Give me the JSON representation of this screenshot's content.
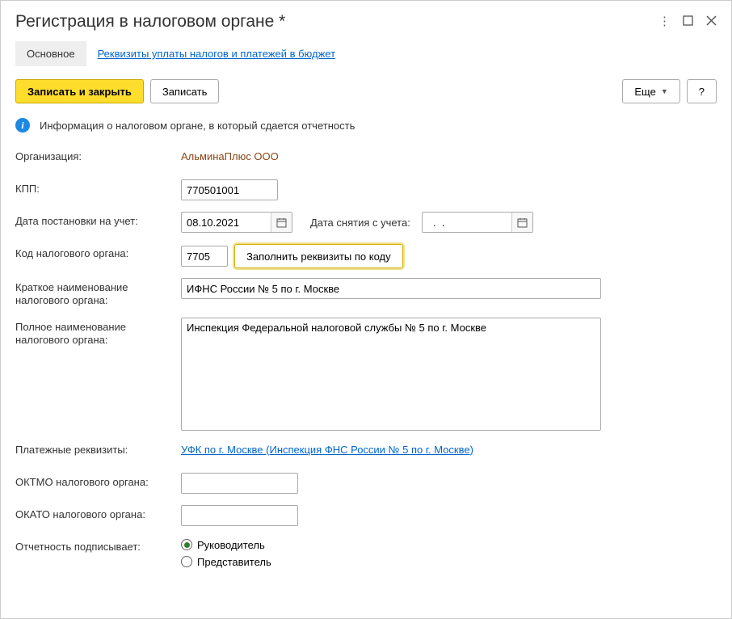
{
  "title": "Регистрация в налоговом органе *",
  "tabs": {
    "main": "Основное",
    "payment": "Реквизиты уплаты налогов и платежей в бюджет"
  },
  "toolbar": {
    "save_close": "Записать и закрыть",
    "save": "Записать",
    "more": "Еще",
    "help": "?"
  },
  "info": "Информация о налоговом органе, в который сдается отчетность",
  "labels": {
    "org": "Организация:",
    "kpp": "КПП:",
    "reg_date": "Дата постановки на учет:",
    "dereg_date": "Дата снятия с учета:",
    "tax_code": "Код налогового органа:",
    "fill_by_code": "Заполнить реквизиты по коду",
    "short_name": "Краткое наименование налогового органа:",
    "full_name": "Полное наименование налогового органа:",
    "payment_details": "Платежные реквизиты:",
    "oktmo": "ОКТМО налогового органа:",
    "okato": "ОКАТО налогового органа:",
    "signer": "Отчетность подписывает:"
  },
  "values": {
    "org": "АльминаПлюс ООО",
    "kpp": "770501001",
    "reg_date": "08.10.2021",
    "dereg_date": "  .  .    ",
    "tax_code": "7705",
    "short_name": "ИФНС России № 5 по г. Москве",
    "full_name": "Инспекция Федеральной налоговой службы № 5 по г. Москве",
    "payment_details": "УФК по г. Москве (Инспекция ФНС России № 5 по г. Москве)",
    "oktmo": "",
    "okato": ""
  },
  "signer_options": {
    "head": "Руководитель",
    "rep": "Представитель"
  }
}
